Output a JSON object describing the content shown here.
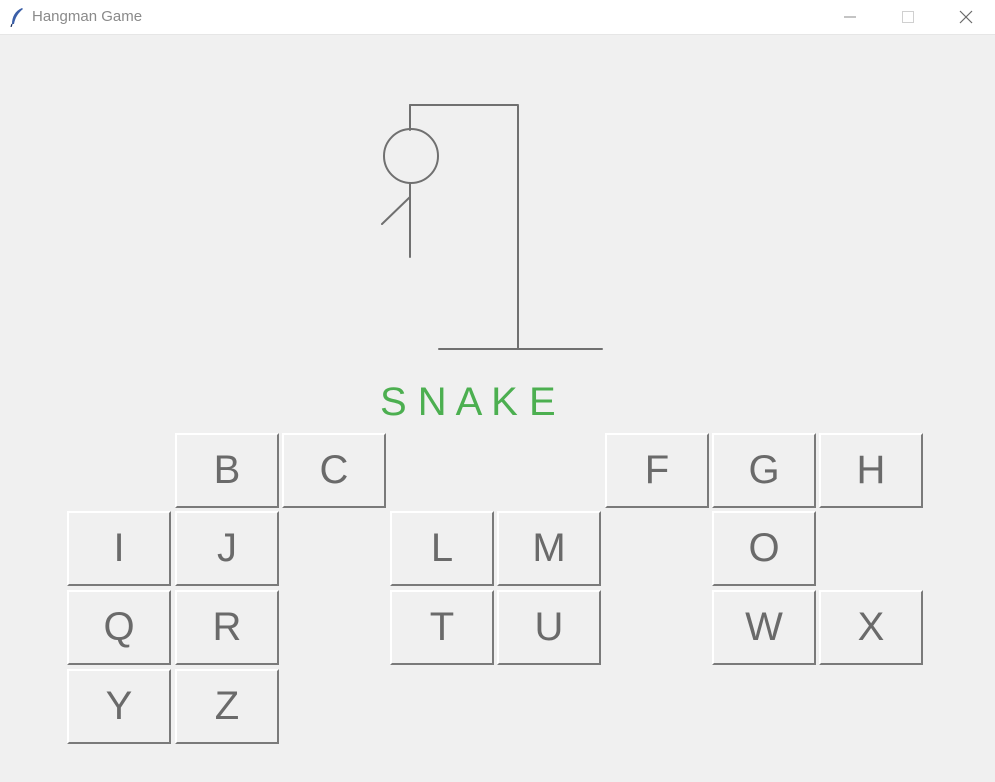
{
  "window": {
    "title": "Hangman Game"
  },
  "word": {
    "display": "S N A K E",
    "color": "#4caf50"
  },
  "icons": {
    "app": "feather-icon",
    "minimize": "minimize-icon",
    "maximize": "maximize-icon",
    "close": "close-icon"
  },
  "hangman": {
    "parts_drawn": [
      "head",
      "body",
      "left-arm"
    ]
  },
  "keys": {
    "B": "B",
    "C": "C",
    "F": "F",
    "G": "G",
    "H": "H",
    "I": "I",
    "J": "J",
    "L": "L",
    "M": "M",
    "O": "O",
    "Q": "Q",
    "R": "R",
    "T": "T",
    "U": "U",
    "W": "W",
    "X": "X",
    "Y": "Y",
    "Z": "Z"
  }
}
